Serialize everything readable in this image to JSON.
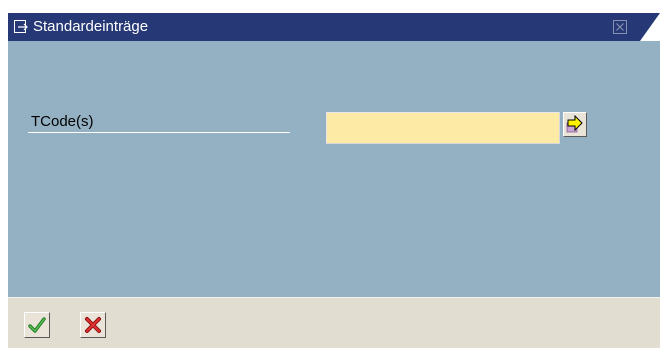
{
  "window": {
    "title": "Standardeinträge",
    "icons": {
      "title": "dialog-icon",
      "close": "close-icon"
    },
    "colors": {
      "titlebar": "#273876",
      "content": "#94b1c3",
      "footer": "#e2ddd1",
      "input": "#fdeba5"
    }
  },
  "form": {
    "tcode_label": "TCode(s)",
    "tcode_value": "",
    "execute_icon": "arrow-right-icon"
  },
  "footer": {
    "confirm_icon": "checkmark-icon",
    "cancel_icon": "cancel-icon"
  }
}
